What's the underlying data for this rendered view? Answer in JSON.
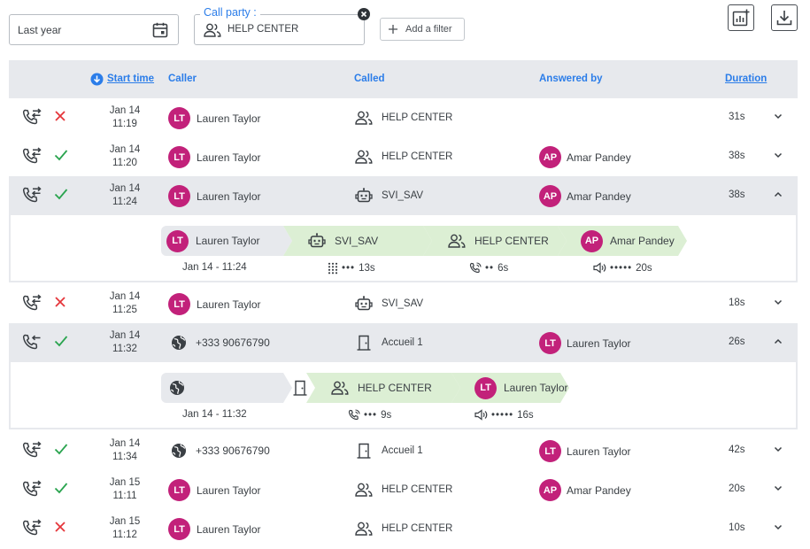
{
  "filters": {
    "date_value": "Last year",
    "call_party_label": "Call party :",
    "call_party_value": "HELP CENTER",
    "add_filter_label": "Add a filter"
  },
  "table": {
    "columns": {
      "start_time": "Start time",
      "caller": "Caller",
      "called": "Called",
      "answered_by": "Answered by",
      "duration": "Duration"
    },
    "rows": [
      {
        "date": "Jan 14",
        "time": "11:19",
        "direction": "transfer",
        "status": "missed",
        "caller_initials": "LT",
        "caller": "Lauren Taylor",
        "called_icon": "group-icon",
        "called": "HELP CENTER",
        "answered_initials": "",
        "answered": "",
        "duration": "31s",
        "expanded": false
      },
      {
        "date": "Jan 14",
        "time": "11:20",
        "direction": "transfer",
        "status": "answered",
        "caller_initials": "LT",
        "caller": "Lauren Taylor",
        "called_icon": "group-icon",
        "called": "HELP CENTER",
        "answered_initials": "AP",
        "answered": "Amar Pandey",
        "duration": "38s",
        "expanded": false
      },
      {
        "date": "Jan 14",
        "time": "11:24",
        "direction": "transfer",
        "status": "answered",
        "caller_initials": "LT",
        "caller": "Lauren Taylor",
        "called_icon": "robot-icon",
        "called": "SVI_SAV",
        "answered_initials": "AP",
        "answered": "Amar Pandey",
        "duration": "38s",
        "expanded": true
      },
      {
        "date": "Jan 14",
        "time": "11:25",
        "direction": "transfer",
        "status": "missed",
        "caller_initials": "LT",
        "caller": "Lauren Taylor",
        "called_icon": "robot-icon",
        "called": "SVI_SAV",
        "answered_initials": "",
        "answered": "",
        "duration": "18s",
        "expanded": false
      },
      {
        "date": "Jan 14",
        "time": "11:32",
        "direction": "incoming",
        "status": "answered",
        "caller_initials": "",
        "caller": "+333 90676790",
        "called_icon": "door-icon",
        "called": "Accueil 1",
        "answered_initials": "LT",
        "answered": "Lauren Taylor",
        "duration": "26s",
        "expanded": true
      },
      {
        "date": "Jan 14",
        "time": "11:34",
        "direction": "transfer",
        "status": "answered",
        "caller_initials": "",
        "caller": "+333 90676790",
        "called_icon": "door-icon",
        "called": "Accueil 1",
        "answered_initials": "LT",
        "answered": "Lauren Taylor",
        "duration": "42s",
        "expanded": false
      },
      {
        "date": "Jan 15",
        "time": "11:11",
        "direction": "transfer",
        "status": "answered",
        "caller_initials": "LT",
        "caller": "Lauren Taylor",
        "called_icon": "group-icon",
        "called": "HELP CENTER",
        "answered_initials": "AP",
        "answered": "Amar Pandey",
        "duration": "20s",
        "expanded": false
      },
      {
        "date": "Jan 15",
        "time": "11:12",
        "direction": "transfer",
        "status": "missed",
        "caller_initials": "LT",
        "caller": "Lauren Taylor",
        "called_icon": "group-icon",
        "called": "HELP CENTER",
        "answered_initials": "",
        "answered": "",
        "duration": "10s",
        "expanded": false
      }
    ]
  },
  "details": [
    {
      "steps": [
        {
          "icon": "avatar",
          "initials": "LT",
          "label": "Lauren Taylor",
          "color": "#e7e9ed"
        },
        {
          "icon": "robot-icon",
          "label": "SVI_SAV",
          "color": "#dcefd4"
        },
        {
          "icon": "group-icon",
          "label": "HELP CENTER",
          "color": "#dcefd4"
        },
        {
          "icon": "avatar",
          "initials": "AP",
          "label": "Amar Pandey",
          "color": "#dcefd4"
        }
      ],
      "start": "Jan 14 - 11:24",
      "metrics": [
        {
          "icon": "keypad-icon",
          "dots": "•••",
          "value": "13s"
        },
        {
          "icon": "ringing-icon",
          "dots": "••",
          "value": "6s"
        },
        {
          "icon": "speaker-icon",
          "dots": "•••••",
          "value": "20s"
        }
      ]
    },
    {
      "steps": [
        {
          "icon": "globe-icon",
          "label": "",
          "color": "#e7e9ed"
        },
        {
          "icon": "door-icon",
          "label": "",
          "color": "#ffffff"
        },
        {
          "icon": "group-icon",
          "label": "HELP CENTER",
          "color": "#dcefd4"
        },
        {
          "icon": "avatar",
          "initials": "LT",
          "label": "Lauren Taylor",
          "color": "#dcefd4"
        }
      ],
      "start": "Jan 14 - 11:32",
      "metrics": [
        {
          "icon": "ringing-icon",
          "dots": "•••",
          "value": "9s"
        },
        {
          "icon": "speaker-icon",
          "dots": "•••••",
          "value": "16s"
        }
      ]
    }
  ],
  "colors": {
    "accent": "#2b7de9",
    "avatar": "#c2217a",
    "missed": "#e5363b",
    "answered": "#2aa44f",
    "row_highlight": "#e7e9ed",
    "step_green": "#dcefd4"
  }
}
